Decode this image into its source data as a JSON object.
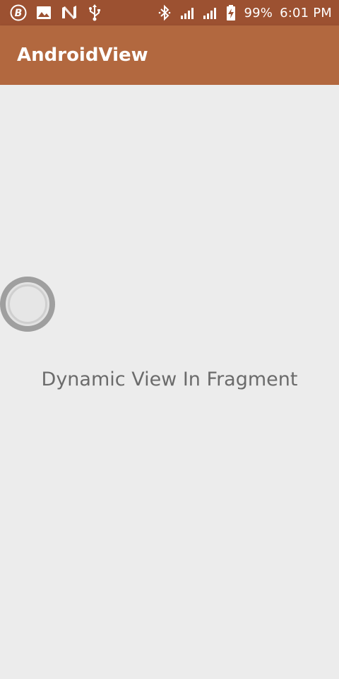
{
  "status_bar": {
    "icons_left": [
      "b-badge-icon",
      "image-icon",
      "n-logo-icon",
      "usb-icon"
    ],
    "icons_right": [
      "bluetooth-icon",
      "signal-1-icon",
      "signal-2-icon",
      "battery-charging-icon"
    ],
    "battery_percent": "99%",
    "time": "6:01 PM",
    "background": "#9c5131"
  },
  "app_bar": {
    "title": "AndroidView",
    "background": "#b2683f"
  },
  "content": {
    "label": "Dynamic View In Fragment",
    "background": "#ececec"
  }
}
